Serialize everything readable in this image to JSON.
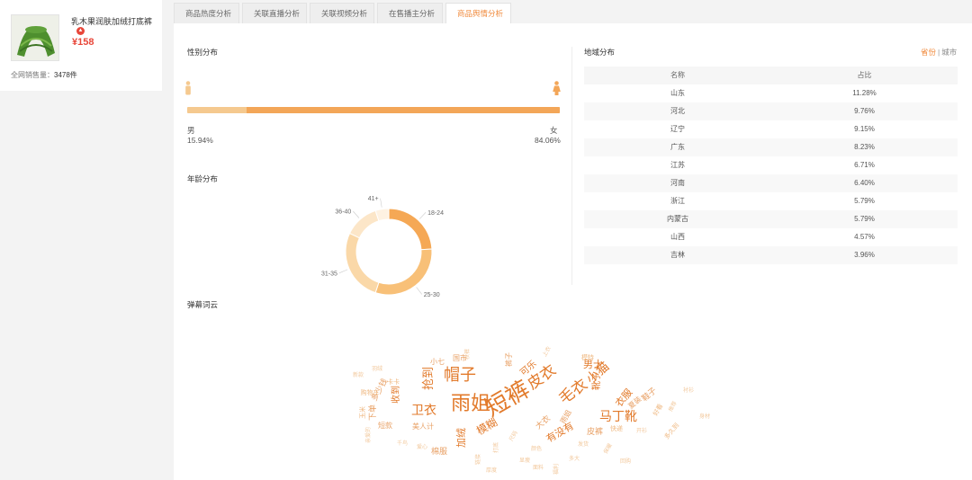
{
  "product": {
    "name": "乳木果润肤加绒打底裤",
    "price": "¥158",
    "sales_label": "全网销售量：",
    "sales_value": "3478件"
  },
  "tabs": [
    {
      "label": "商品热度分析",
      "active": false
    },
    {
      "label": "关联直播分析",
      "active": false
    },
    {
      "label": "关联视频分析",
      "active": false
    },
    {
      "label": "在售播主分析",
      "active": false
    },
    {
      "label": "商品舆情分析",
      "active": true
    }
  ],
  "gender": {
    "title": "性别分布",
    "male_label": "男",
    "male_pct": "15.94%",
    "female_label": "女",
    "female_pct": "84.06%",
    "female_fraction": 0.8406
  },
  "age": {
    "title": "年龄分布"
  },
  "region": {
    "title": "地域分布",
    "switch_province": "省份",
    "switch_sep": "|",
    "switch_city": "城市",
    "col_name": "名称",
    "col_pct": "占比",
    "rows": [
      {
        "name": "山东",
        "pct": "11.28%"
      },
      {
        "name": "河北",
        "pct": "9.76%"
      },
      {
        "name": "辽宁",
        "pct": "9.15%"
      },
      {
        "name": "广东",
        "pct": "8.23%"
      },
      {
        "name": "江苏",
        "pct": "6.71%"
      },
      {
        "name": "河南",
        "pct": "6.40%"
      },
      {
        "name": "浙江",
        "pct": "5.79%"
      },
      {
        "name": "内蒙古",
        "pct": "5.79%"
      },
      {
        "name": "山西",
        "pct": "4.57%"
      },
      {
        "name": "吉林",
        "pct": "3.96%"
      }
    ]
  },
  "wordcloud": {
    "title": "弹幕词云"
  },
  "chart_data": {
    "type": "pie",
    "categories": [
      "18-24",
      "25-30",
      "31-35",
      "36-40",
      "41+"
    ],
    "values": [
      24,
      31,
      27,
      13,
      5
    ],
    "colors": [
      "#f5a855",
      "#f8c078",
      "#fad8a8",
      "#fce6c8",
      "#fef2e2"
    ]
  },
  "cloud_words": [
    {
      "t": "雨姐",
      "s": 22,
      "c": "#e27a2b",
      "r": 0
    },
    {
      "t": "短裤",
      "s": 26,
      "c": "#e27a2b",
      "r": -30
    },
    {
      "t": "帽子",
      "s": 18,
      "c": "#e27a2b",
      "r": 0
    },
    {
      "t": "皮衣",
      "s": 17,
      "c": "#e27a2b",
      "r": -35
    },
    {
      "t": "毛衣",
      "s": 17,
      "c": "#e27a2b",
      "r": -35
    },
    {
      "t": "小猫",
      "s": 14,
      "c": "#e27a2b",
      "r": -40
    },
    {
      "t": "马丁靴",
      "s": 14,
      "c": "#e27a2b",
      "r": 0
    },
    {
      "t": "卫衣",
      "s": 14,
      "c": "#e27a2b",
      "r": 0
    },
    {
      "t": "抢到",
      "s": 13,
      "c": "#e27a2b",
      "r": -90
    },
    {
      "t": "模糊",
      "s": 12,
      "c": "#e27a2b",
      "r": -30
    },
    {
      "t": "有没有",
      "s": 11,
      "c": "#e27a2b",
      "r": -30
    },
    {
      "t": "衣服",
      "s": 11,
      "c": "#e27a2b",
      "r": -50
    },
    {
      "t": "男士",
      "s": 11,
      "c": "#e27a2b",
      "r": 0
    },
    {
      "t": "加绒",
      "s": 11,
      "c": "#e27a2b",
      "r": -90
    },
    {
      "t": "收到",
      "s": 10,
      "c": "#e27a2b",
      "r": -90
    },
    {
      "t": "可乐",
      "s": 10,
      "c": "#e27a2b",
      "r": -40
    },
    {
      "t": "靴子",
      "s": 10,
      "c": "#e27a2b",
      "r": -90
    },
    {
      "t": "皮裤",
      "s": 9,
      "c": "#e8a065",
      "r": 0
    },
    {
      "t": "多少钱",
      "s": 9,
      "c": "#e8a065",
      "r": -60
    },
    {
      "t": "下单",
      "s": 9,
      "c": "#e8a065",
      "r": -90
    },
    {
      "t": "美人计",
      "s": 8,
      "c": "#e8a065",
      "r": 0
    },
    {
      "t": "雨姐",
      "s": 8,
      "c": "#e8a065",
      "r": -60
    },
    {
      "t": "大衣",
      "s": 9,
      "c": "#e8a065",
      "r": -40
    },
    {
      "t": "棉服",
      "s": 9,
      "c": "#e8a065",
      "r": 0
    },
    {
      "t": "鞋子",
      "s": 9,
      "c": "#e8a065",
      "r": -40
    },
    {
      "t": "短款",
      "s": 8,
      "c": "#e8a065",
      "r": 0
    },
    {
      "t": "夏装",
      "s": 8,
      "c": "#e8a065",
      "r": -40
    },
    {
      "t": "小七",
      "s": 8,
      "c": "#e8a065",
      "r": 0
    },
    {
      "t": "国市",
      "s": 8,
      "c": "#e8a065",
      "r": 0
    },
    {
      "t": "裤子",
      "s": 8,
      "c": "#e8a065",
      "r": -90
    },
    {
      "t": "快递",
      "s": 7,
      "c": "#efb983",
      "r": 0
    },
    {
      "t": "玉米",
      "s": 7,
      "c": "#efb983",
      "r": -90
    },
    {
      "t": "购物车",
      "s": 7,
      "c": "#efb983",
      "r": 0
    },
    {
      "t": "卡卡",
      "s": 7,
      "c": "#efb983",
      "r": 0
    },
    {
      "t": "模特",
      "s": 7,
      "c": "#efb983",
      "r": 0
    },
    {
      "t": "好看",
      "s": 7,
      "c": "#efb983",
      "r": -60
    },
    {
      "t": "多久到",
      "s": 7,
      "c": "#efb983",
      "r": -50
    },
    {
      "t": "发货",
      "s": 6,
      "c": "#f2c89c",
      "r": 0
    },
    {
      "t": "开衫",
      "s": 6,
      "c": "#f2c89c",
      "r": 0
    },
    {
      "t": "推荐",
      "s": 6,
      "c": "#f2c89c",
      "r": -60
    },
    {
      "t": "爱心",
      "s": 6,
      "c": "#f2c89c",
      "r": 0
    },
    {
      "t": "身材",
      "s": 6,
      "c": "#f2c89c",
      "r": 0
    },
    {
      "t": "千鸟",
      "s": 6,
      "c": "#f2c89c",
      "r": 0
    },
    {
      "t": "亲爱的",
      "s": 6,
      "c": "#f2c89c",
      "r": -90
    },
    {
      "t": "衬衫",
      "s": 6,
      "c": "#f2c89c",
      "r": 0
    },
    {
      "t": "秋裤",
      "s": 6,
      "c": "#f2c89c",
      "r": -90
    },
    {
      "t": "羽绒",
      "s": 6,
      "c": "#f2c89c",
      "r": 0
    },
    {
      "t": "上衣",
      "s": 6,
      "c": "#f2c89c",
      "r": -60
    },
    {
      "t": "新款",
      "s": 6,
      "c": "#f2c89c",
      "r": 0
    },
    {
      "t": "打底",
      "s": 6,
      "c": "#f2c89c",
      "r": -90
    },
    {
      "t": "颜色",
      "s": 6,
      "c": "#f2c89c",
      "r": 0
    },
    {
      "t": "尺码",
      "s": 6,
      "c": "#f2c89c",
      "r": -60
    },
    {
      "t": "显瘦",
      "s": 6,
      "c": "#f2c89c",
      "r": 0
    },
    {
      "t": "链接",
      "s": 6,
      "c": "#f2c89c",
      "r": -90
    },
    {
      "t": "多大",
      "s": 6,
      "c": "#f2c89c",
      "r": 0
    },
    {
      "t": "保暖",
      "s": 6,
      "c": "#f2c89c",
      "r": -60
    },
    {
      "t": "面料",
      "s": 6,
      "c": "#f2c89c",
      "r": 0
    },
    {
      "t": "福利",
      "s": 6,
      "c": "#f2c89c",
      "r": -90
    },
    {
      "t": "厚度",
      "s": 6,
      "c": "#f2c89c",
      "r": 0
    },
    {
      "t": "回购",
      "s": 6,
      "c": "#f2c89c",
      "r": 0
    }
  ]
}
